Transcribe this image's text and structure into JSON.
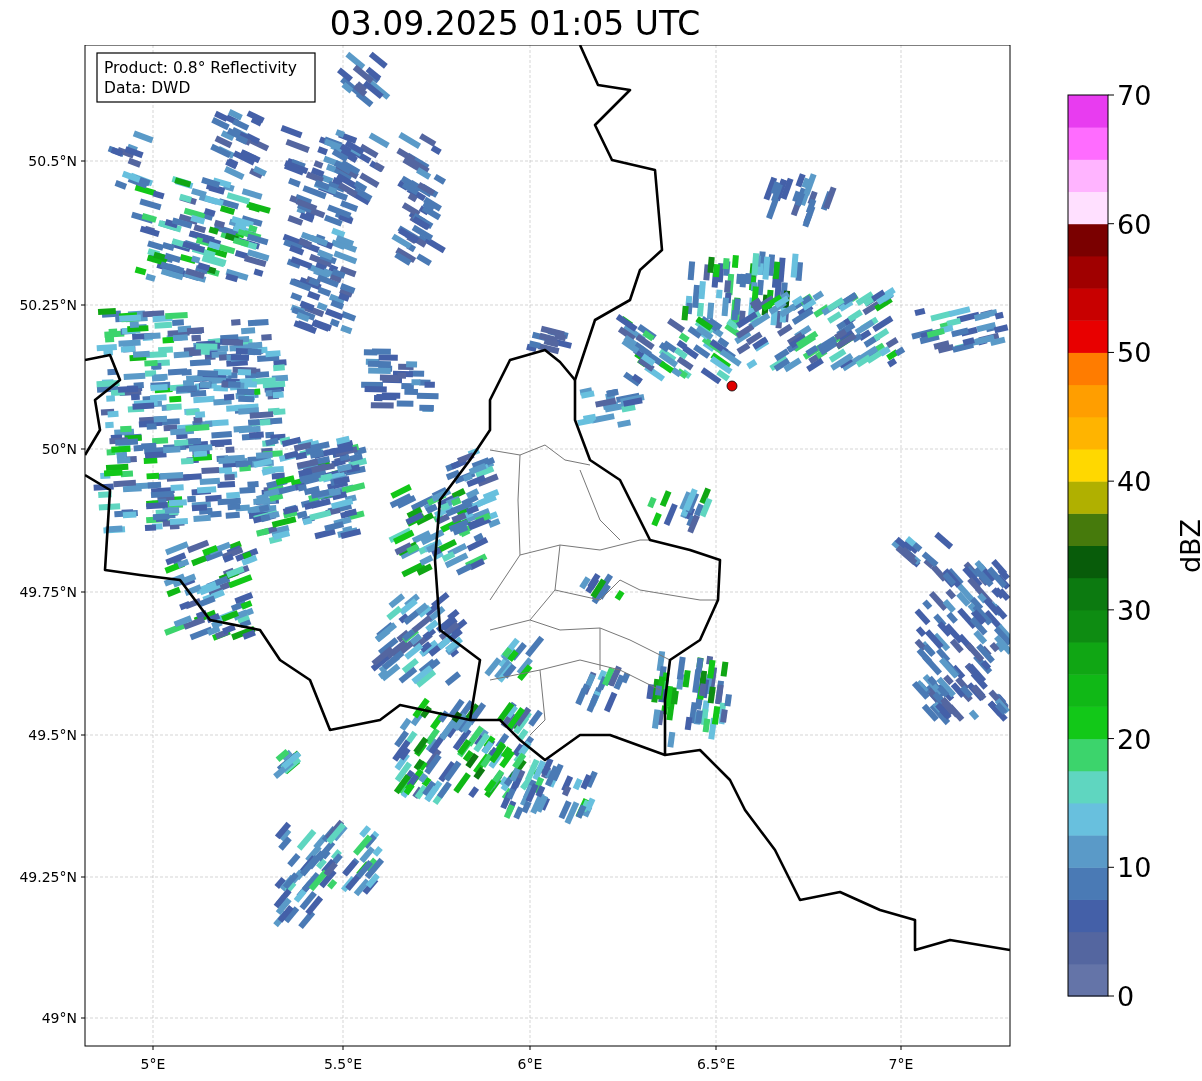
{
  "title": "03.09.2025 01:05 UTC",
  "info_box": {
    "lines": [
      "Product: 0.8° Reflectivity",
      "Data: DWD"
    ]
  },
  "map": {
    "xticks": [
      "5°E",
      "5.5°E",
      "6°E",
      "6.5°E",
      "7°E"
    ],
    "yticks": [
      "50.5°N",
      "50.25°N",
      "50°N",
      "49.75°N",
      "49.5°N",
      "49.25°N",
      "49°N"
    ]
  },
  "colorbar": {
    "label": "dBZ",
    "ticks": [
      "70",
      "60",
      "50",
      "40",
      "30",
      "20",
      "10",
      "0"
    ],
    "bins": [
      {
        "color": "#6474a8"
      },
      {
        "color": "#5466a0"
      },
      {
        "color": "#4460a8"
      },
      {
        "color": "#4a7ab5"
      },
      {
        "color": "#5a9ac8"
      },
      {
        "color": "#68c0de"
      },
      {
        "color": "#5fd6c0"
      },
      {
        "color": "#3cd46c"
      },
      {
        "color": "#12c818"
      },
      {
        "color": "#10b816"
      },
      {
        "color": "#10a614"
      },
      {
        "color": "#0e8c12"
      },
      {
        "color": "#0c7a10"
      },
      {
        "color": "#085c0a"
      },
      {
        "color": "#467a0c"
      },
      {
        "color": "#b0b000"
      },
      {
        "color": "#ffd800"
      },
      {
        "color": "#ffb400"
      },
      {
        "color": "#ff9e00"
      },
      {
        "color": "#ff7c00"
      },
      {
        "color": "#e80000"
      },
      {
        "color": "#c80000"
      },
      {
        "color": "#a00000"
      },
      {
        "color": "#7a0000"
      },
      {
        "color": "#ffe0ff"
      },
      {
        "color": "#ffb4ff"
      },
      {
        "color": "#ff6cff"
      },
      {
        "color": "#e83cf0"
      }
    ]
  }
}
